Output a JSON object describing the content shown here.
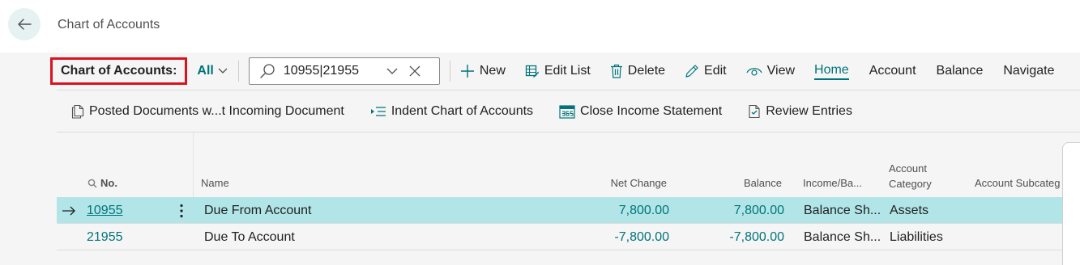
{
  "page": {
    "title": "Chart of Accounts"
  },
  "actionbar": {
    "caption": "Chart of Accounts:",
    "view_filter": "All",
    "search_value": "10955|21955",
    "actions": {
      "new": "New",
      "edit_list": "Edit List",
      "delete": "Delete",
      "edit": "Edit",
      "view": "View"
    },
    "menus": [
      "Home",
      "Account",
      "Balance",
      "Navigate"
    ]
  },
  "promoted": {
    "posted_docs": "Posted Documents w...t Incoming Document",
    "indent": "Indent Chart of Accounts",
    "close_income": "Close Income Statement",
    "review": "Review Entries"
  },
  "grid": {
    "headers": {
      "no": "No.",
      "name": "Name",
      "net_change": "Net Change",
      "balance": "Balance",
      "income_balance": "Income/Ba...",
      "category_line1": "Account",
      "category_line2": "Category",
      "subcategory": "Account Subcateg"
    },
    "rows": [
      {
        "no": "10955",
        "name": "Due From Account",
        "net_change": "7,800.00",
        "balance": "7,800.00",
        "income_balance": "Balance Sh...",
        "category": "Assets",
        "subcategory": ""
      },
      {
        "no": "21955",
        "name": "Due To Account",
        "net_change": "-7,800.00",
        "balance": "-7,800.00",
        "income_balance": "Balance Sh...",
        "category": "Liabilities",
        "subcategory": ""
      }
    ]
  },
  "colors": {
    "accent": "#00747a",
    "selected_row": "#b1e5e8",
    "highlight_box": "#d9141e",
    "background": "#f5f5f5"
  }
}
